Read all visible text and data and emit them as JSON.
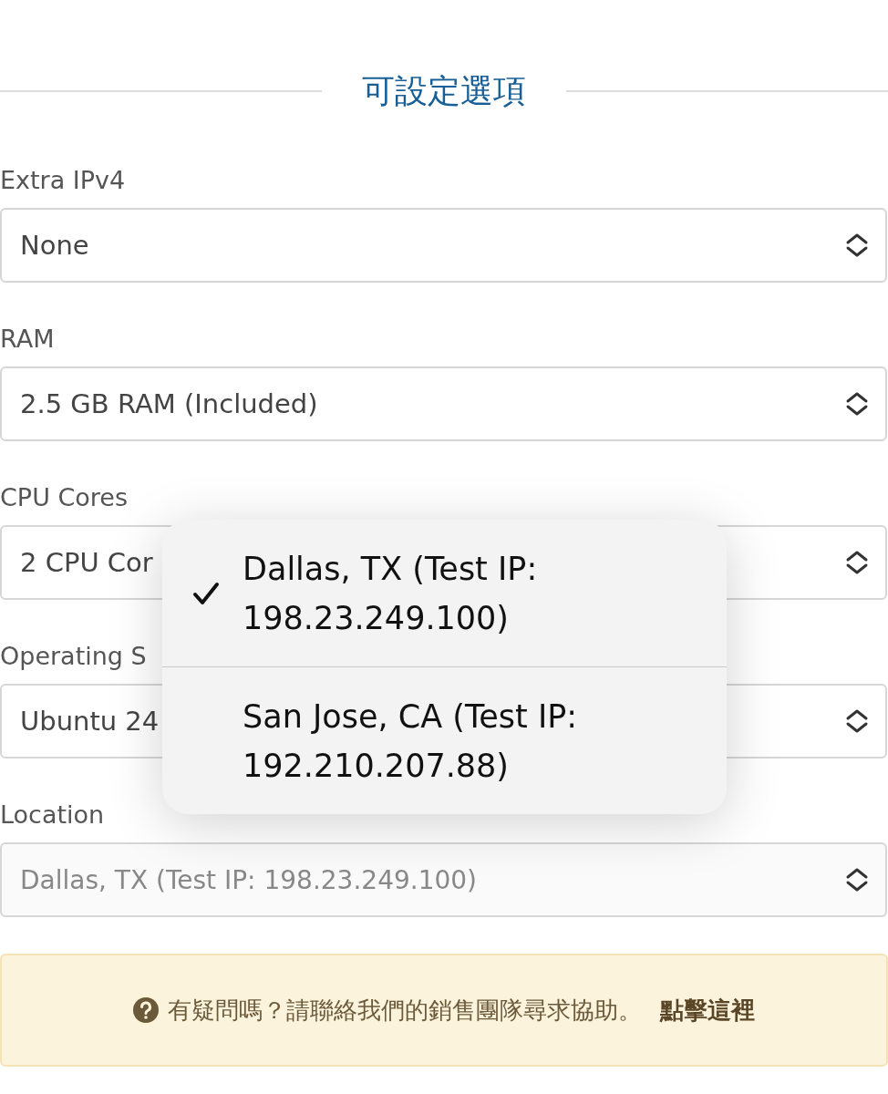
{
  "section_title": "可設定選項",
  "fields": [
    {
      "label": "Extra IPv4",
      "value": "None",
      "disabled": false
    },
    {
      "label": "RAM",
      "value": "2.5 GB RAM (Included)",
      "disabled": false
    },
    {
      "label": "CPU Cores",
      "value": "2 CPU Cor",
      "disabled": false
    },
    {
      "label": "Operating S",
      "value": "Ubuntu 24",
      "disabled": false
    },
    {
      "label": "Location",
      "value": "Dallas, TX (Test IP: 198.23.249.100)",
      "disabled": true
    }
  ],
  "dropdown_menu": {
    "options": [
      {
        "label": "Dallas, TX (Test IP: 198.23.249.100)",
        "selected": true
      },
      {
        "label": "San Jose, CA (Test IP: 192.210.207.88)",
        "selected": false
      }
    ]
  },
  "notice": {
    "text": "有疑問嗎？請聯絡我們的銷售團隊尋求協助。",
    "link": "點擊這裡"
  }
}
